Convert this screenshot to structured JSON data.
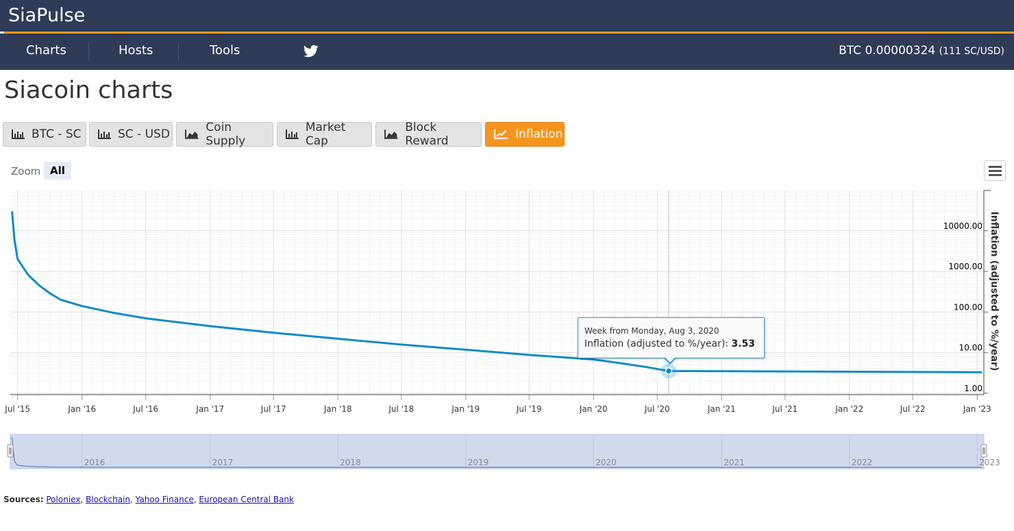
{
  "app": {
    "brand": "SiaPulse",
    "nav": [
      "Charts",
      "Hosts",
      "Tools"
    ],
    "price_main": "BTC 0.00000324",
    "price_sub": "(111 SC/USD)"
  },
  "page": {
    "title": "Siacoin charts",
    "buttons": [
      "BTC - SC",
      "SC - USD",
      "Coin Supply",
      "Market Cap",
      "Block Reward",
      "Inflation"
    ],
    "active_button": "Inflation",
    "zoom_label": "Zoom",
    "zoom_all": "All"
  },
  "colors": {
    "header_bg": "#2f3b57",
    "accent": "#f7941d",
    "series": "#0e8ac8",
    "navigator_fill": "#ccd6eb"
  },
  "chart_data": {
    "type": "line",
    "series": [
      {
        "name": "Inflation (adjusted to %/year)",
        "x": [
          "2015-06-15",
          "2015-06-22",
          "2015-07-01",
          "2015-08-01",
          "2015-09-01",
          "2015-10-01",
          "2015-11-01",
          "2016-01-01",
          "2016-04-01",
          "2016-07-01",
          "2017-01-01",
          "2017-07-01",
          "2018-01-01",
          "2018-07-01",
          "2019-01-01",
          "2019-07-01",
          "2020-01-01",
          "2020-04-01",
          "2020-06-01",
          "2020-08-03",
          "2021-01-01",
          "2021-07-01",
          "2022-01-01",
          "2022-07-01",
          "2023-01-01",
          "2023-01-15"
        ],
        "y": [
          30000,
          6000,
          2000,
          800,
          450,
          290,
          200,
          140,
          95,
          70,
          45,
          31,
          22,
          15.8,
          11.8,
          8.8,
          6.8,
          5.3,
          4.4,
          3.53,
          3.5,
          3.45,
          3.4,
          3.35,
          3.3,
          3.28
        ]
      }
    ],
    "x_ticks": [
      "Jul '15",
      "Jan '16",
      "Jul '16",
      "Jan '17",
      "Jul '17",
      "Jan '18",
      "Jul '18",
      "Jan '19",
      "Jul '19",
      "Jan '20",
      "Jul '20",
      "Jan '21",
      "Jul '21",
      "Jan '22",
      "Jul '22",
      "Jan '23"
    ],
    "y_ticks": [
      "10000.00",
      "1000.00",
      "100.00",
      "10.00",
      "1.00"
    ],
    "y_scale": "log",
    "ylim": [
      1,
      50000
    ],
    "ylabel": "Inflation (adjusted to %/year)",
    "navigator_labels": [
      "2016",
      "2017",
      "2018",
      "2019",
      "2020",
      "2021",
      "2022",
      "2023"
    ],
    "tooltip": {
      "header": "Week from Monday, Aug 3, 2020",
      "series_label": "Inflation (adjusted to %/year):",
      "value": "3.53"
    },
    "grid": true,
    "legend": "none"
  },
  "sources": {
    "label": "Sources:",
    "links": [
      "Poloniex",
      "Blockchain",
      "Yahoo Finance",
      "European Central Bank"
    ]
  }
}
